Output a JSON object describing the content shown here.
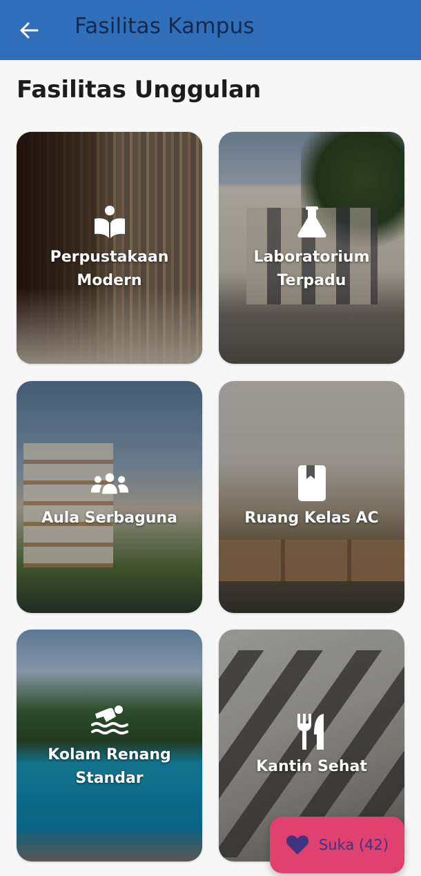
{
  "app_bar": {
    "title": "Fasilitas Kampus",
    "back_icon": "arrow-left-icon",
    "color": "#2f6fba"
  },
  "section": {
    "title": "Fasilitas Unggulan"
  },
  "facilities": [
    {
      "label": "Perpustakaan Modern",
      "icon": "book-reader-icon"
    },
    {
      "label": "Laboratorium Terpadu",
      "icon": "flask-icon"
    },
    {
      "label": "Aula Serbaguna",
      "icon": "people-group-icon"
    },
    {
      "label": "Ruang Kelas AC",
      "icon": "bookmark-book-icon"
    },
    {
      "label": "Kolam Renang Standar",
      "icon": "swimmer-icon"
    },
    {
      "label": "Kantin Sehat",
      "icon": "utensils-icon"
    }
  ],
  "like_button": {
    "label": "Suka (42)",
    "icon": "heart-icon",
    "color": "#e0406e"
  }
}
